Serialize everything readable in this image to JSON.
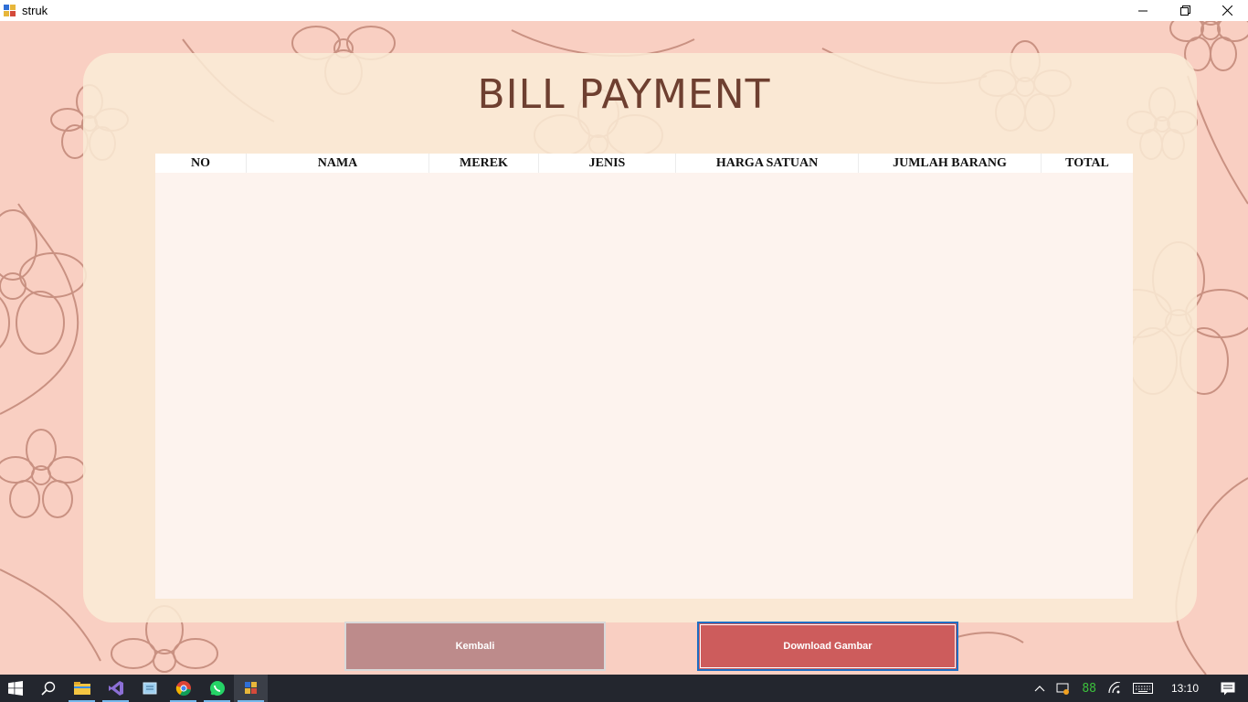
{
  "window": {
    "title": "struk",
    "icons": [
      "app-icon",
      "minimize-icon",
      "restore-icon",
      "close-icon"
    ]
  },
  "page": {
    "title": "BILL PAYMENT"
  },
  "table": {
    "columns": [
      "NO",
      "NAMA",
      "MEREK",
      "JENIS",
      "HARGA SATUAN",
      "JUMLAH BARANG",
      "TOTAL"
    ],
    "rows": []
  },
  "buttons": {
    "back_label": "Kembali",
    "download_label": "Download Gambar"
  },
  "taskbar": {
    "apps": [
      "windows-start-icon",
      "search-icon",
      "file-explorer-icon",
      "visual-studio-icon",
      "notepad-icon",
      "chrome-icon",
      "whatsapp-icon",
      "struk-app-icon"
    ],
    "battery": "88",
    "time": "13:10"
  },
  "colors": {
    "background": "#f9cfc2",
    "panel": "#faecd6",
    "title": "#6e3f30",
    "grid": "#fdf3ee",
    "back_button": "#bd8b8b",
    "download_button": "#cd5c5c",
    "taskbar": "#23262e"
  }
}
